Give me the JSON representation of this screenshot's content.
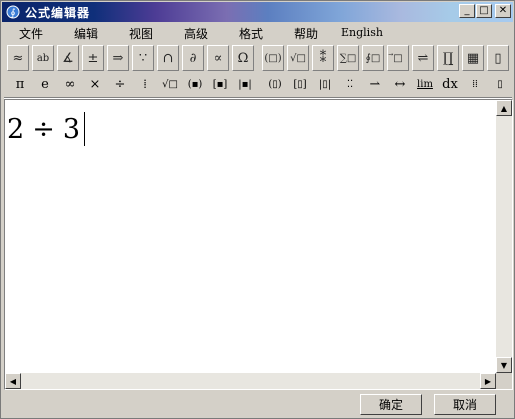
{
  "window": {
    "title": "公式编辑器"
  },
  "title_buttons": {
    "minimize": "_",
    "maximize": "□",
    "close": "✕"
  },
  "menu": [
    {
      "label": "文件"
    },
    {
      "label": "编辑"
    },
    {
      "label": "视图"
    },
    {
      "label": "高级"
    },
    {
      "label": "格式"
    },
    {
      "label": "帮助"
    },
    {
      "label": "English"
    }
  ],
  "toolbar_row1": [
    {
      "glyph": "≈",
      "icon": "relations-icon"
    },
    {
      "glyph": "ab",
      "icon": "spacing-icon"
    },
    {
      "glyph": "∡",
      "icon": "embellishment-icon"
    },
    {
      "glyph": "±",
      "icon": "operators-icon"
    },
    {
      "glyph": "⇒",
      "icon": "arrows-icon"
    },
    {
      "glyph": "∵",
      "icon": "logic-icon"
    },
    {
      "glyph": "∩",
      "icon": "set-theory-icon"
    },
    {
      "glyph": "∂",
      "icon": "misc-symbols-icon"
    },
    {
      "glyph": "∝",
      "icon": "greek-lower-icon"
    },
    {
      "glyph": "Ω",
      "icon": "greek-upper-icon"
    },
    {
      "glyph": "(□)",
      "icon": "fence-template-icon"
    },
    {
      "glyph": "√□",
      "icon": "fraction-radical-icon"
    },
    {
      "glyph": "⁑",
      "icon": "subscript-template-icon"
    },
    {
      "glyph": "∑□",
      "icon": "summation-template-icon"
    },
    {
      "glyph": "∮□",
      "icon": "integral-template-icon"
    },
    {
      "glyph": "⃗□",
      "icon": "overbar-template-icon"
    },
    {
      "glyph": "⇌",
      "icon": "labeled-arrow-icon"
    },
    {
      "glyph": "∏̲",
      "icon": "product-template-icon"
    },
    {
      "glyph": "▦",
      "icon": "matrix-template-icon"
    },
    {
      "glyph": "▯",
      "icon": "box-template-icon"
    }
  ],
  "toolbar_row2": [
    {
      "glyph": "π",
      "icon": "pi-symbol-icon"
    },
    {
      "glyph": "e",
      "icon": "e-symbol-icon"
    },
    {
      "glyph": "∞",
      "icon": "infinity-symbol-icon"
    },
    {
      "glyph": "×",
      "icon": "times-symbol-icon"
    },
    {
      "glyph": "÷",
      "icon": "divide-symbol-icon"
    },
    {
      "glyph": "⁞",
      "icon": "fraction-small-icon"
    },
    {
      "glyph": "√□",
      "icon": "sqrt-small-icon"
    },
    {
      "glyph": "(▪)",
      "icon": "parentheses-small-icon"
    },
    {
      "glyph": "[▪]",
      "icon": "brackets-small-icon"
    },
    {
      "glyph": "|▪|",
      "icon": "abs-small-icon"
    },
    {
      "glyph": "(▯)",
      "icon": "paren-template-small-icon"
    },
    {
      "glyph": "[▯]",
      "icon": "bracket-template-small-icon"
    },
    {
      "glyph": "|▯|",
      "icon": "bar-template-small-icon"
    },
    {
      "glyph": "⁚⁚",
      "icon": "script-template-small-icon"
    },
    {
      "glyph": "⇀",
      "icon": "harpoon-arrow-icon"
    },
    {
      "glyph": "↔",
      "icon": "double-arrow-icon"
    },
    {
      "glyph": "lim",
      "icon": "limit-template-icon"
    },
    {
      "glyph": "dx",
      "icon": "differential-icon"
    },
    {
      "glyph": "⁞⁞",
      "icon": "matrix-small-icon"
    },
    {
      "glyph": "▯",
      "icon": "misc-template-icon"
    }
  ],
  "formula": {
    "left": "2",
    "operator": "÷",
    "right": "3"
  },
  "buttons": {
    "ok": "确定",
    "cancel": "取消"
  }
}
